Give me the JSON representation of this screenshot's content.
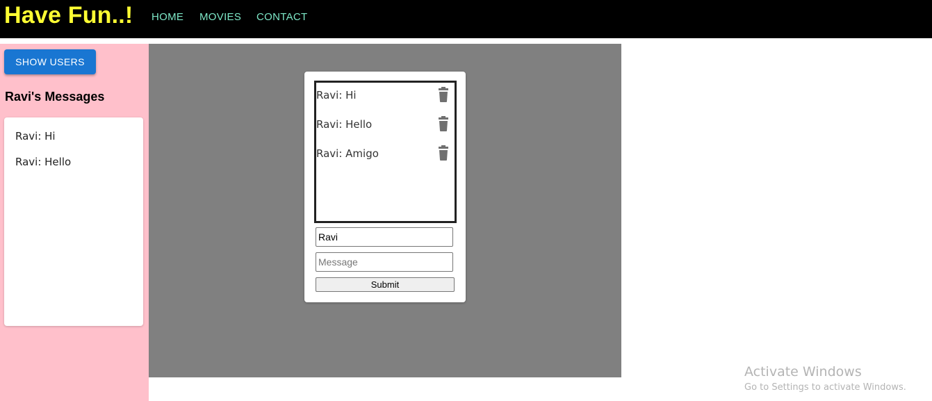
{
  "navbar": {
    "brand": "Have Fun..!",
    "brand_color": "#ffff33",
    "links": [
      {
        "label": "HOME"
      },
      {
        "label": "MOVIES"
      },
      {
        "label": "CONTACT"
      }
    ],
    "link_color": "#7ee8c8"
  },
  "sidebar": {
    "background": "#ffc0cb",
    "show_users_label": "SHOW USERS",
    "title": "Ravi's Messages",
    "messages": [
      "Ravi: Hi",
      "Ravi: Hello"
    ]
  },
  "chat": {
    "messages": [
      {
        "text": "Ravi: Hi",
        "icon": "trash-icon"
      },
      {
        "text": "Ravi: Hello",
        "icon": "trash-icon"
      },
      {
        "text": "Ravi: Amigo",
        "icon": "trash-icon"
      }
    ],
    "name_value": "Ravi",
    "message_placeholder": "Message",
    "submit_label": "Submit"
  },
  "watermark": {
    "title": "Activate Windows",
    "subtitle": "Go to Settings to activate Windows."
  },
  "colors": {
    "accent": "#1976d2",
    "stage": "#808080"
  }
}
